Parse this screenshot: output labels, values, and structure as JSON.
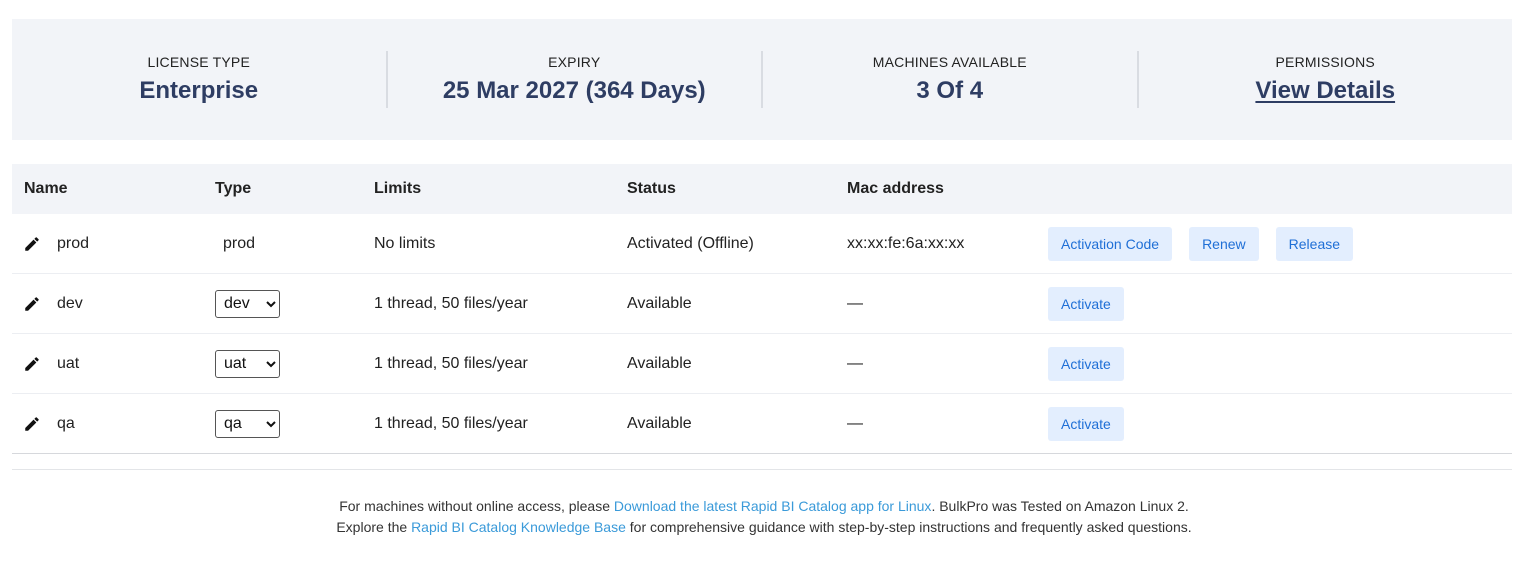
{
  "summary": {
    "license_type_label": "LICENSE TYPE",
    "license_type_value": "Enterprise",
    "expiry_label": "EXPIRY",
    "expiry_value": "25 Mar 2027 (364 Days)",
    "machines_label": "MACHINES AVAILABLE",
    "machines_value": "3 Of 4",
    "permissions_label": "PERMISSIONS",
    "permissions_link": "View Details"
  },
  "table": {
    "headers": {
      "name": "Name",
      "type": "Type",
      "limits": "Limits",
      "status": "Status",
      "mac": "Mac address"
    },
    "rows": [
      {
        "name": "prod",
        "type": "prod",
        "limits": "No limits",
        "status": "Activated (Offline)",
        "mac": "xx:xx:fe:6a:xx:xx",
        "actions": [
          "Activation Code",
          "Renew",
          "Release"
        ]
      },
      {
        "name": "dev",
        "type": "dev",
        "limits": "1 thread, 50 files/year",
        "status": "Available",
        "mac": "—",
        "actions": [
          "Activate"
        ]
      },
      {
        "name": "uat",
        "type": "uat",
        "limits": "1 thread, 50 files/year",
        "status": "Available",
        "mac": "—",
        "actions": [
          "Activate"
        ]
      },
      {
        "name": "qa",
        "type": "qa",
        "limits": "1 thread, 50 files/year",
        "status": "Available",
        "mac": "—",
        "actions": [
          "Activate"
        ]
      }
    ]
  },
  "footer": {
    "line1_prefix": "For machines without online access, please ",
    "line1_link": "Download the latest Rapid BI Catalog app for Linux",
    "line1_suffix": ". BulkPro was Tested on Amazon Linux 2.",
    "line2_prefix": "Explore the ",
    "line2_link": "Rapid BI Catalog Knowledge Base",
    "line2_suffix": " for comprehensive guidance with step-by-step instructions and frequently asked questions."
  },
  "icons": {
    "edit": "pencil-icon"
  },
  "colors": {
    "panel_bg": "#f2f4f8",
    "value_text": "#2e3d63",
    "button_bg": "#e3eefe",
    "button_text": "#1f6fd6",
    "link_text": "#3a9ad9"
  }
}
